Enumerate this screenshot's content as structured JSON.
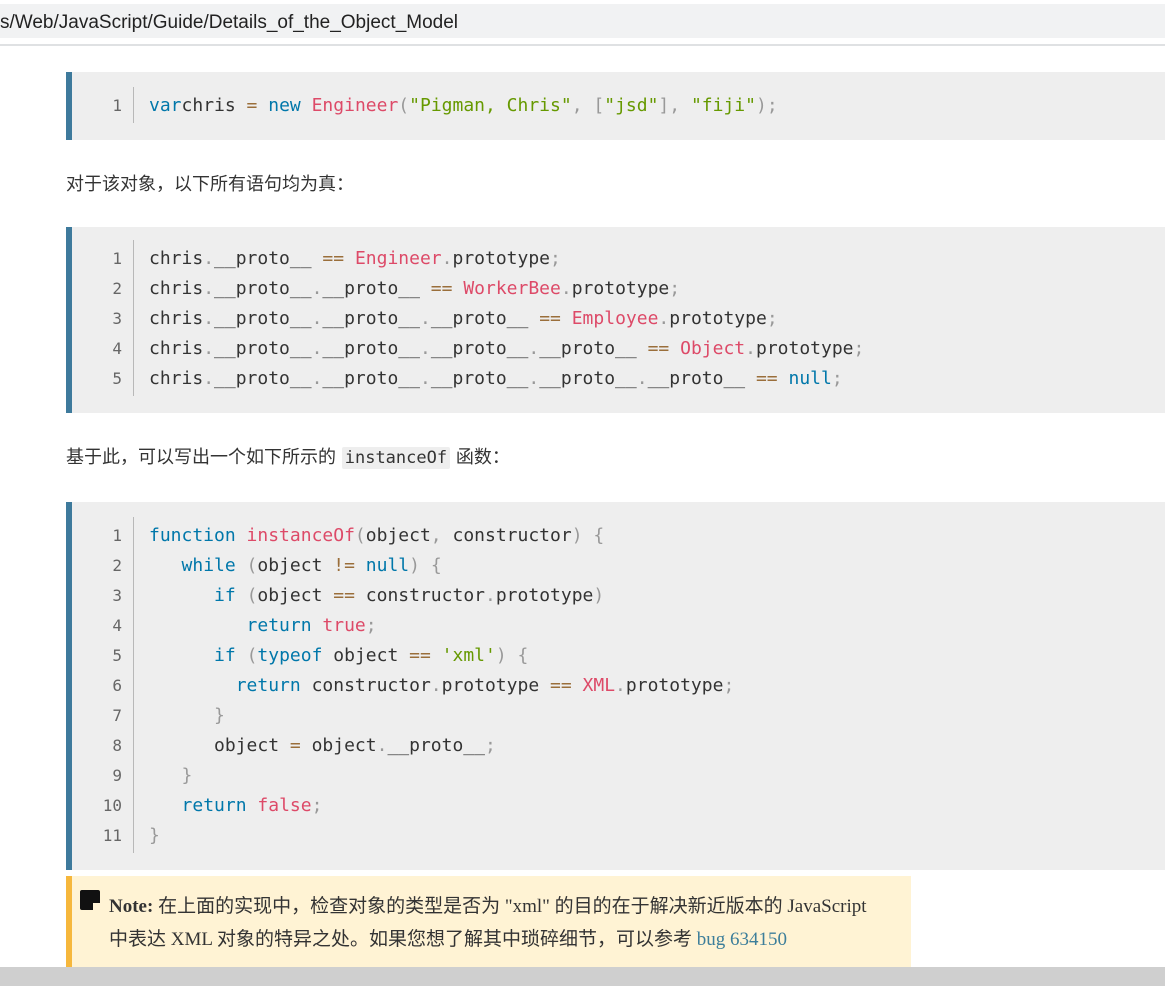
{
  "address_bar": {
    "url": "s/Web/JavaScript/Guide/Details_of_the_Object_Model"
  },
  "code1": {
    "lines": [
      {
        "num": "1",
        "tokens": [
          [
            "kw",
            "var"
          ],
          [
            "",
            "chris "
          ],
          [
            "op",
            "="
          ],
          [
            "",
            " "
          ],
          [
            "kw",
            "new"
          ],
          [
            "",
            " "
          ],
          [
            "fn",
            "Engineer"
          ],
          [
            "pn",
            "("
          ],
          [
            "str",
            "\"Pigman, Chris\""
          ],
          [
            "pn",
            ","
          ],
          [
            "",
            " "
          ],
          [
            "pn",
            "["
          ],
          [
            "str",
            "\"jsd\""
          ],
          [
            "pn",
            "],"
          ],
          [
            "",
            " "
          ],
          [
            "str",
            "\"fiji\""
          ],
          [
            "pn",
            ");"
          ]
        ]
      }
    ]
  },
  "para1": "对于该对象，以下所有语句均为真：",
  "code2": {
    "lines": [
      {
        "num": "1",
        "tokens": [
          [
            "",
            "chris"
          ],
          [
            "pn",
            "."
          ],
          [
            "",
            "__proto__ "
          ],
          [
            "op",
            "=="
          ],
          [
            "",
            " "
          ],
          [
            "fn",
            "Engineer"
          ],
          [
            "pn",
            "."
          ],
          [
            "",
            "prototype"
          ],
          [
            "pn",
            ";"
          ]
        ]
      },
      {
        "num": "2",
        "tokens": [
          [
            "",
            "chris"
          ],
          [
            "pn",
            "."
          ],
          [
            "",
            "__proto__"
          ],
          [
            "pn",
            "."
          ],
          [
            "",
            "__proto__ "
          ],
          [
            "op",
            "=="
          ],
          [
            "",
            " "
          ],
          [
            "fn",
            "WorkerBee"
          ],
          [
            "pn",
            "."
          ],
          [
            "",
            "prototype"
          ],
          [
            "pn",
            ";"
          ]
        ]
      },
      {
        "num": "3",
        "tokens": [
          [
            "",
            "chris"
          ],
          [
            "pn",
            "."
          ],
          [
            "",
            "__proto__"
          ],
          [
            "pn",
            "."
          ],
          [
            "",
            "__proto__"
          ],
          [
            "pn",
            "."
          ],
          [
            "",
            "__proto__ "
          ],
          [
            "op",
            "=="
          ],
          [
            "",
            " "
          ],
          [
            "fn",
            "Employee"
          ],
          [
            "pn",
            "."
          ],
          [
            "",
            "prototype"
          ],
          [
            "pn",
            ";"
          ]
        ]
      },
      {
        "num": "4",
        "tokens": [
          [
            "",
            "chris"
          ],
          [
            "pn",
            "."
          ],
          [
            "",
            "__proto__"
          ],
          [
            "pn",
            "."
          ],
          [
            "",
            "__proto__"
          ],
          [
            "pn",
            "."
          ],
          [
            "",
            "__proto__"
          ],
          [
            "pn",
            "."
          ],
          [
            "",
            "__proto__ "
          ],
          [
            "op",
            "=="
          ],
          [
            "",
            " "
          ],
          [
            "fn",
            "Object"
          ],
          [
            "pn",
            "."
          ],
          [
            "",
            "prototype"
          ],
          [
            "pn",
            ";"
          ]
        ]
      },
      {
        "num": "5",
        "tokens": [
          [
            "",
            "chris"
          ],
          [
            "pn",
            "."
          ],
          [
            "",
            "__proto__"
          ],
          [
            "pn",
            "."
          ],
          [
            "",
            "__proto__"
          ],
          [
            "pn",
            "."
          ],
          [
            "",
            "__proto__"
          ],
          [
            "pn",
            "."
          ],
          [
            "",
            "__proto__"
          ],
          [
            "pn",
            "."
          ],
          [
            "",
            "__proto__ "
          ],
          [
            "op",
            "=="
          ],
          [
            "",
            " "
          ],
          [
            "kw",
            "null"
          ],
          [
            "pn",
            ";"
          ]
        ]
      }
    ]
  },
  "para2": {
    "before": "基于此，可以写出一个如下所示的 ",
    "code": "instanceOf",
    "after": " 函数："
  },
  "code3": {
    "lines": [
      {
        "num": "1",
        "tokens": [
          [
            "kw",
            "function"
          ],
          [
            "",
            " "
          ],
          [
            "fn",
            "instanceOf"
          ],
          [
            "pn",
            "("
          ],
          [
            "",
            "object"
          ],
          [
            "pn",
            ","
          ],
          [
            "",
            " constructor"
          ],
          [
            "pn",
            ")"
          ],
          [
            "",
            " "
          ],
          [
            "pn",
            "{"
          ]
        ]
      },
      {
        "num": "2",
        "tokens": [
          [
            "",
            "   "
          ],
          [
            "kw",
            "while"
          ],
          [
            "",
            " "
          ],
          [
            "pn",
            "("
          ],
          [
            "",
            "object "
          ],
          [
            "op",
            "!="
          ],
          [
            "",
            " "
          ],
          [
            "kw",
            "null"
          ],
          [
            "pn",
            ")"
          ],
          [
            "",
            " "
          ],
          [
            "pn",
            "{"
          ]
        ]
      },
      {
        "num": "3",
        "tokens": [
          [
            "",
            "      "
          ],
          [
            "kw",
            "if"
          ],
          [
            "",
            " "
          ],
          [
            "pn",
            "("
          ],
          [
            "",
            "object "
          ],
          [
            "op",
            "=="
          ],
          [
            "",
            " constructor"
          ],
          [
            "pn",
            "."
          ],
          [
            "",
            "prototype"
          ],
          [
            "pn",
            ")"
          ]
        ]
      },
      {
        "num": "4",
        "tokens": [
          [
            "",
            "         "
          ],
          [
            "kw",
            "return"
          ],
          [
            "",
            " "
          ],
          [
            "fn",
            "true"
          ],
          [
            "pn",
            ";"
          ]
        ]
      },
      {
        "num": "5",
        "tokens": [
          [
            "",
            "      "
          ],
          [
            "kw",
            "if"
          ],
          [
            "",
            " "
          ],
          [
            "pn",
            "("
          ],
          [
            "kw",
            "typeof"
          ],
          [
            "",
            " object "
          ],
          [
            "op",
            "=="
          ],
          [
            "",
            " "
          ],
          [
            "str",
            "'xml'"
          ],
          [
            "pn",
            ")"
          ],
          [
            "",
            " "
          ],
          [
            "pn",
            "{"
          ]
        ]
      },
      {
        "num": "6",
        "tokens": [
          [
            "",
            "        "
          ],
          [
            "kw",
            "return"
          ],
          [
            "",
            " constructor"
          ],
          [
            "pn",
            "."
          ],
          [
            "",
            "prototype "
          ],
          [
            "op",
            "=="
          ],
          [
            "",
            " "
          ],
          [
            "fn",
            "XML"
          ],
          [
            "pn",
            "."
          ],
          [
            "",
            "prototype"
          ],
          [
            "pn",
            ";"
          ]
        ]
      },
      {
        "num": "7",
        "tokens": [
          [
            "",
            "      "
          ],
          [
            "pn",
            "}"
          ]
        ]
      },
      {
        "num": "8",
        "tokens": [
          [
            "",
            "      object "
          ],
          [
            "op",
            "="
          ],
          [
            "",
            " object"
          ],
          [
            "pn",
            "."
          ],
          [
            "",
            "__proto__"
          ],
          [
            "pn",
            ";"
          ]
        ]
      },
      {
        "num": "9",
        "tokens": [
          [
            "",
            "   "
          ],
          [
            "pn",
            "}"
          ]
        ]
      },
      {
        "num": "10",
        "tokens": [
          [
            "",
            "   "
          ],
          [
            "kw",
            "return"
          ],
          [
            "",
            " "
          ],
          [
            "fn",
            "false"
          ],
          [
            "pn",
            ";"
          ]
        ]
      },
      {
        "num": "11",
        "tokens": [
          [
            "pn",
            "}"
          ]
        ]
      }
    ]
  },
  "note": {
    "label": "Note:",
    "text": " 在上面的实现中，检查对象的类型是否为 \"xml\" 的目的在于解决新近版本的 JavaScript 中表达 XML 对象的特异之处。如果您想了解其中琐碎细节，可以参考 ",
    "link": "bug 634150"
  }
}
